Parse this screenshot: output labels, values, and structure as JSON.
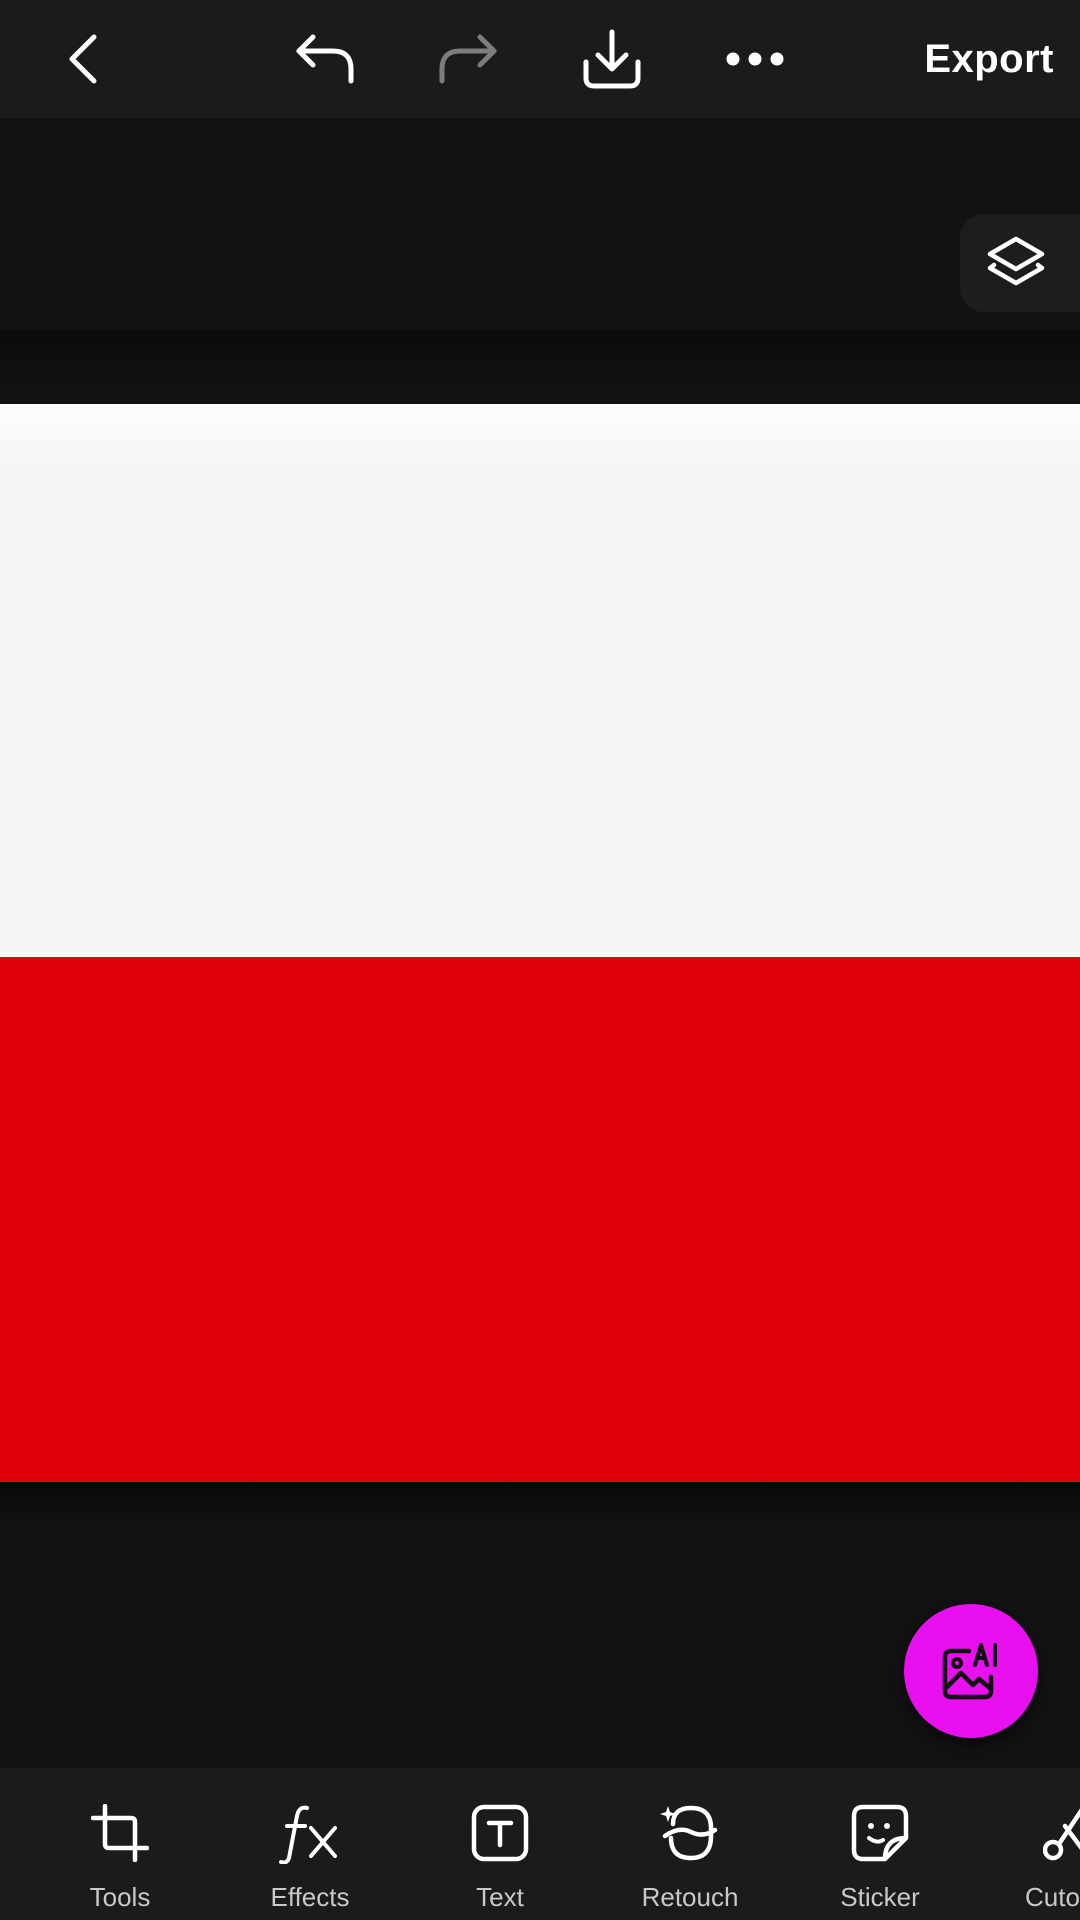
{
  "topbar": {
    "back_icon": "chevron-left-icon",
    "undo_icon": "undo-icon",
    "redo_icon": "redo-icon",
    "download_icon": "download-icon",
    "more_icon": "more-horizontal-icon",
    "export_label": "Export"
  },
  "canvas": {
    "layers_icon": "layers-icon",
    "image": {
      "top_color": "#f5f5f6",
      "bottom_color": "#e0000a"
    },
    "ai_button_icon": "ai-image-icon",
    "ai_button_color": "#e910ef"
  },
  "toolbar": {
    "items": [
      {
        "label": "Tools",
        "icon": "crop-icon"
      },
      {
        "label": "Effects",
        "icon": "fx-icon"
      },
      {
        "label": "Text",
        "icon": "text-icon"
      },
      {
        "label": "Retouch",
        "icon": "retouch-icon"
      },
      {
        "label": "Sticker",
        "icon": "sticker-icon"
      },
      {
        "label": "Cuto",
        "icon": "scissors-icon"
      }
    ]
  }
}
